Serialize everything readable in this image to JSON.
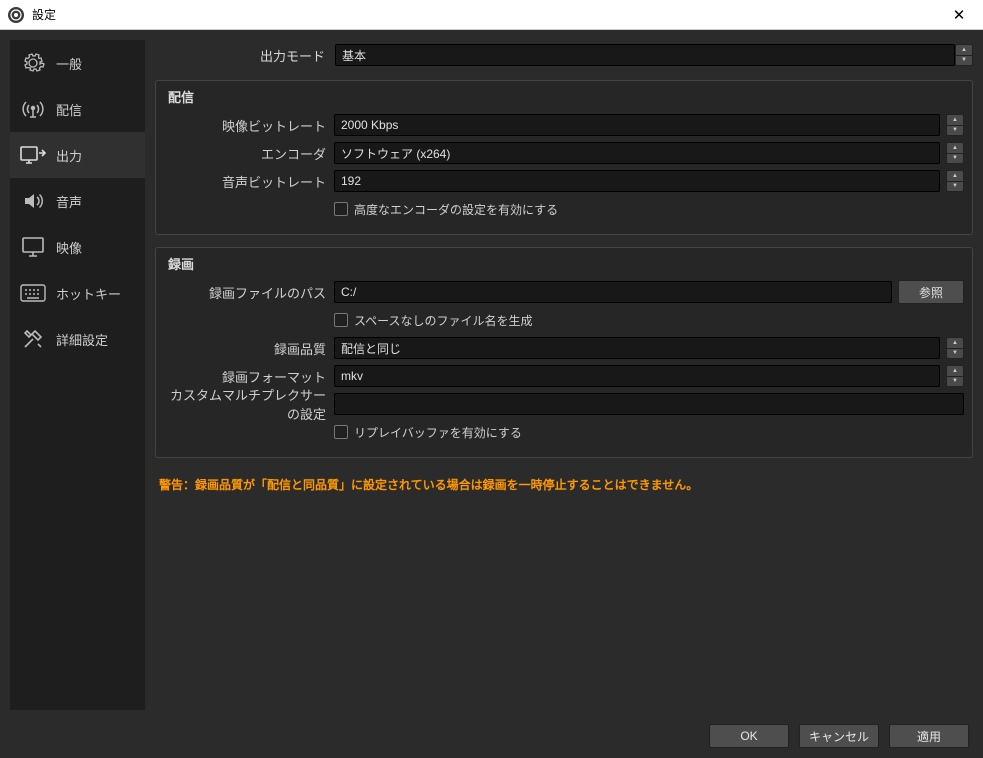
{
  "window": {
    "title": "設定"
  },
  "sidebar": {
    "items": [
      {
        "label": "一般"
      },
      {
        "label": "配信"
      },
      {
        "label": "出力"
      },
      {
        "label": "音声"
      },
      {
        "label": "映像"
      },
      {
        "label": "ホットキー"
      },
      {
        "label": "詳細設定"
      }
    ]
  },
  "output_mode": {
    "label": "出力モード",
    "value": "基本"
  },
  "streaming": {
    "title": "配信",
    "video_bitrate_label": "映像ビットレート",
    "video_bitrate_value": "2000 Kbps",
    "encoder_label": "エンコーダ",
    "encoder_value": "ソフトウェア (x264)",
    "audio_bitrate_label": "音声ビットレート",
    "audio_bitrate_value": "192",
    "advanced_checkbox": "高度なエンコーダの設定を有効にする"
  },
  "recording": {
    "title": "録画",
    "path_label": "録画ファイルのパス",
    "path_value": "C:/",
    "browse": "参照",
    "no_space_checkbox": "スペースなしのファイル名を生成",
    "quality_label": "録画品質",
    "quality_value": "配信と同じ",
    "format_label": "録画フォーマット",
    "format_value": "mkv",
    "custom_mux_label": "カスタムマルチプレクサーの設定",
    "custom_mux_value": "",
    "replay_buffer_checkbox": "リプレイバッファを有効にする"
  },
  "warning": "警告：録画品質が「配信と同品質」に設定されている場合は録画を一時停止することはできません。",
  "footer": {
    "ok": "OK",
    "cancel": "キャンセル",
    "apply": "適用"
  }
}
